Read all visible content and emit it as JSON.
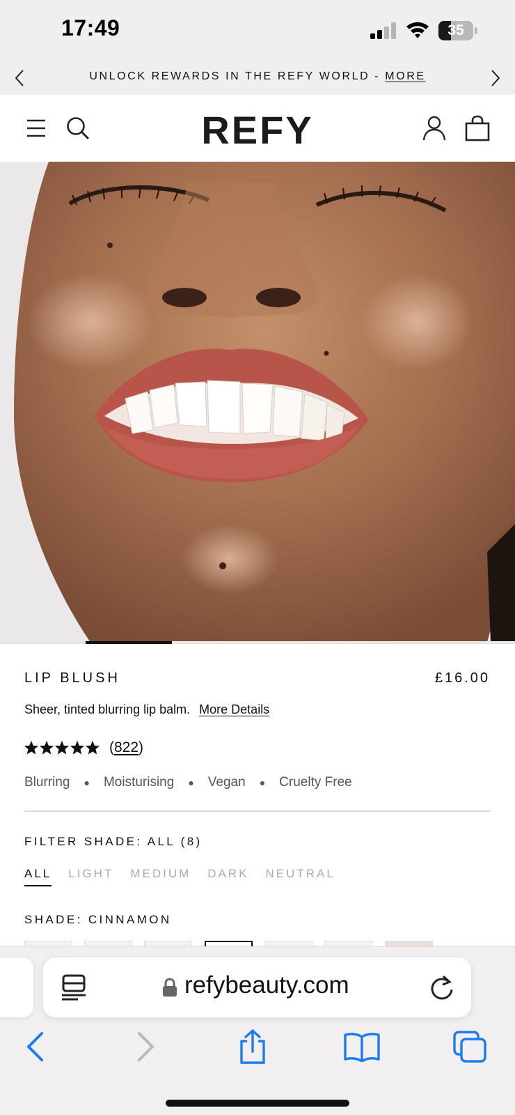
{
  "status_bar": {
    "time": "17:49",
    "battery_level": "35",
    "battery_fraction": 0.35
  },
  "announcement": {
    "text": "UNLOCK REWARDS IN THE REFY WORLD -",
    "link": "MORE"
  },
  "header": {
    "logo": "REFY"
  },
  "carousel": {
    "active_index": 1,
    "progress_fraction": 0.17
  },
  "product": {
    "title": "LIP BLUSH",
    "price": "£16.00",
    "description": "Sheer, tinted blurring lip balm.",
    "more_details": "More Details",
    "rating": 4.8,
    "review_count": "822",
    "features": [
      "Blurring",
      "Moisturising",
      "Vegan",
      "Cruelty Free"
    ]
  },
  "filters": {
    "label": "FILTER SHADE: ALL (8)",
    "tabs": [
      {
        "label": "ALL",
        "active": true
      },
      {
        "label": "LIGHT",
        "active": false
      },
      {
        "label": "MEDIUM",
        "active": false
      },
      {
        "label": "DARK",
        "active": false
      },
      {
        "label": "NEUTRAL",
        "active": false
      }
    ]
  },
  "shade": {
    "label": "SHADE: CINNAMON",
    "selected_index": 3
  },
  "browser": {
    "url": "refybeauty.com"
  },
  "colors": {
    "accent_blue": "#1a7cf0",
    "disabled_gray": "#b8b8b8",
    "lip": "#b8554a"
  },
  "icons": {
    "nav_back": "chevron-left-icon",
    "nav_forward": "chevron-right-icon",
    "share": "share-icon",
    "bookmarks": "book-icon",
    "tabs": "tabs-icon"
  }
}
